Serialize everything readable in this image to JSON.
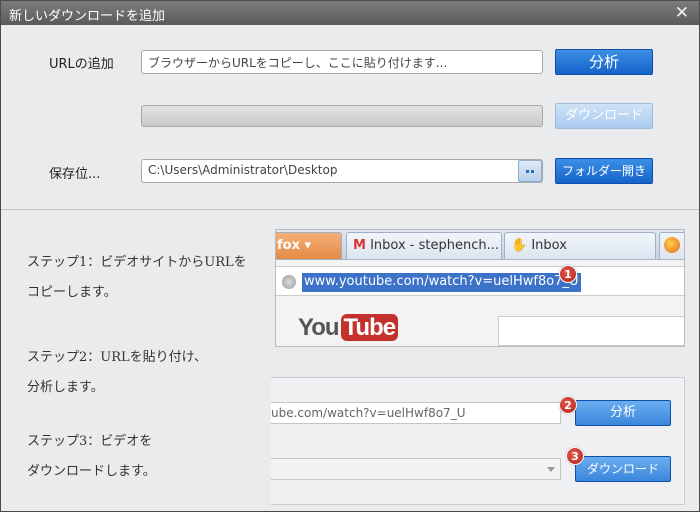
{
  "window": {
    "title": "新しいダウンロードを追加",
    "close_glyph": "✕"
  },
  "form": {
    "url_label": "URLの追加",
    "url_placeholder": "ブラウザーからURLをコピーし、ここに貼り付けます...",
    "analyze_label": "分析",
    "download_label": "ダウンロード",
    "progress_value": 0,
    "save_label": "保存位...",
    "save_path": "C:\\Users\\Administrator\\Desktop",
    "open_folder_label": "フォルダー開き"
  },
  "steps": [
    {
      "line1": "ステップ1：ビデオサイトからURLを",
      "line2": "コピーします。"
    },
    {
      "line1": "ステップ2：URLを貼り付け、",
      "line2": "分析します。"
    },
    {
      "line1": "ステップ3：ビデオを",
      "line2": "ダウンロードします。"
    }
  ],
  "illustration": {
    "tabs": [
      "fox ▾",
      "Inbox - stephench...",
      "Inbox"
    ],
    "gmail_icon": "gmail-icon",
    "hand_icon": "hand-icon",
    "firefox_icon": "firefox-icon",
    "address": "www.youtube.com/watch?v=uelHwf8o7_U",
    "yt_you": "You",
    "yt_tube": "Tube",
    "step2_url": "ube.com/watch?v=uelHwf8o7_U",
    "step2_analyze": "分析",
    "step3_download": "ダウンロード",
    "badges": [
      "1",
      "2",
      "3"
    ]
  },
  "colors": {
    "accent": "#1a6fd6",
    "badge": "#c0392b",
    "title_bg": "#6b6b6b",
    "highlight": "#3c73c9"
  }
}
